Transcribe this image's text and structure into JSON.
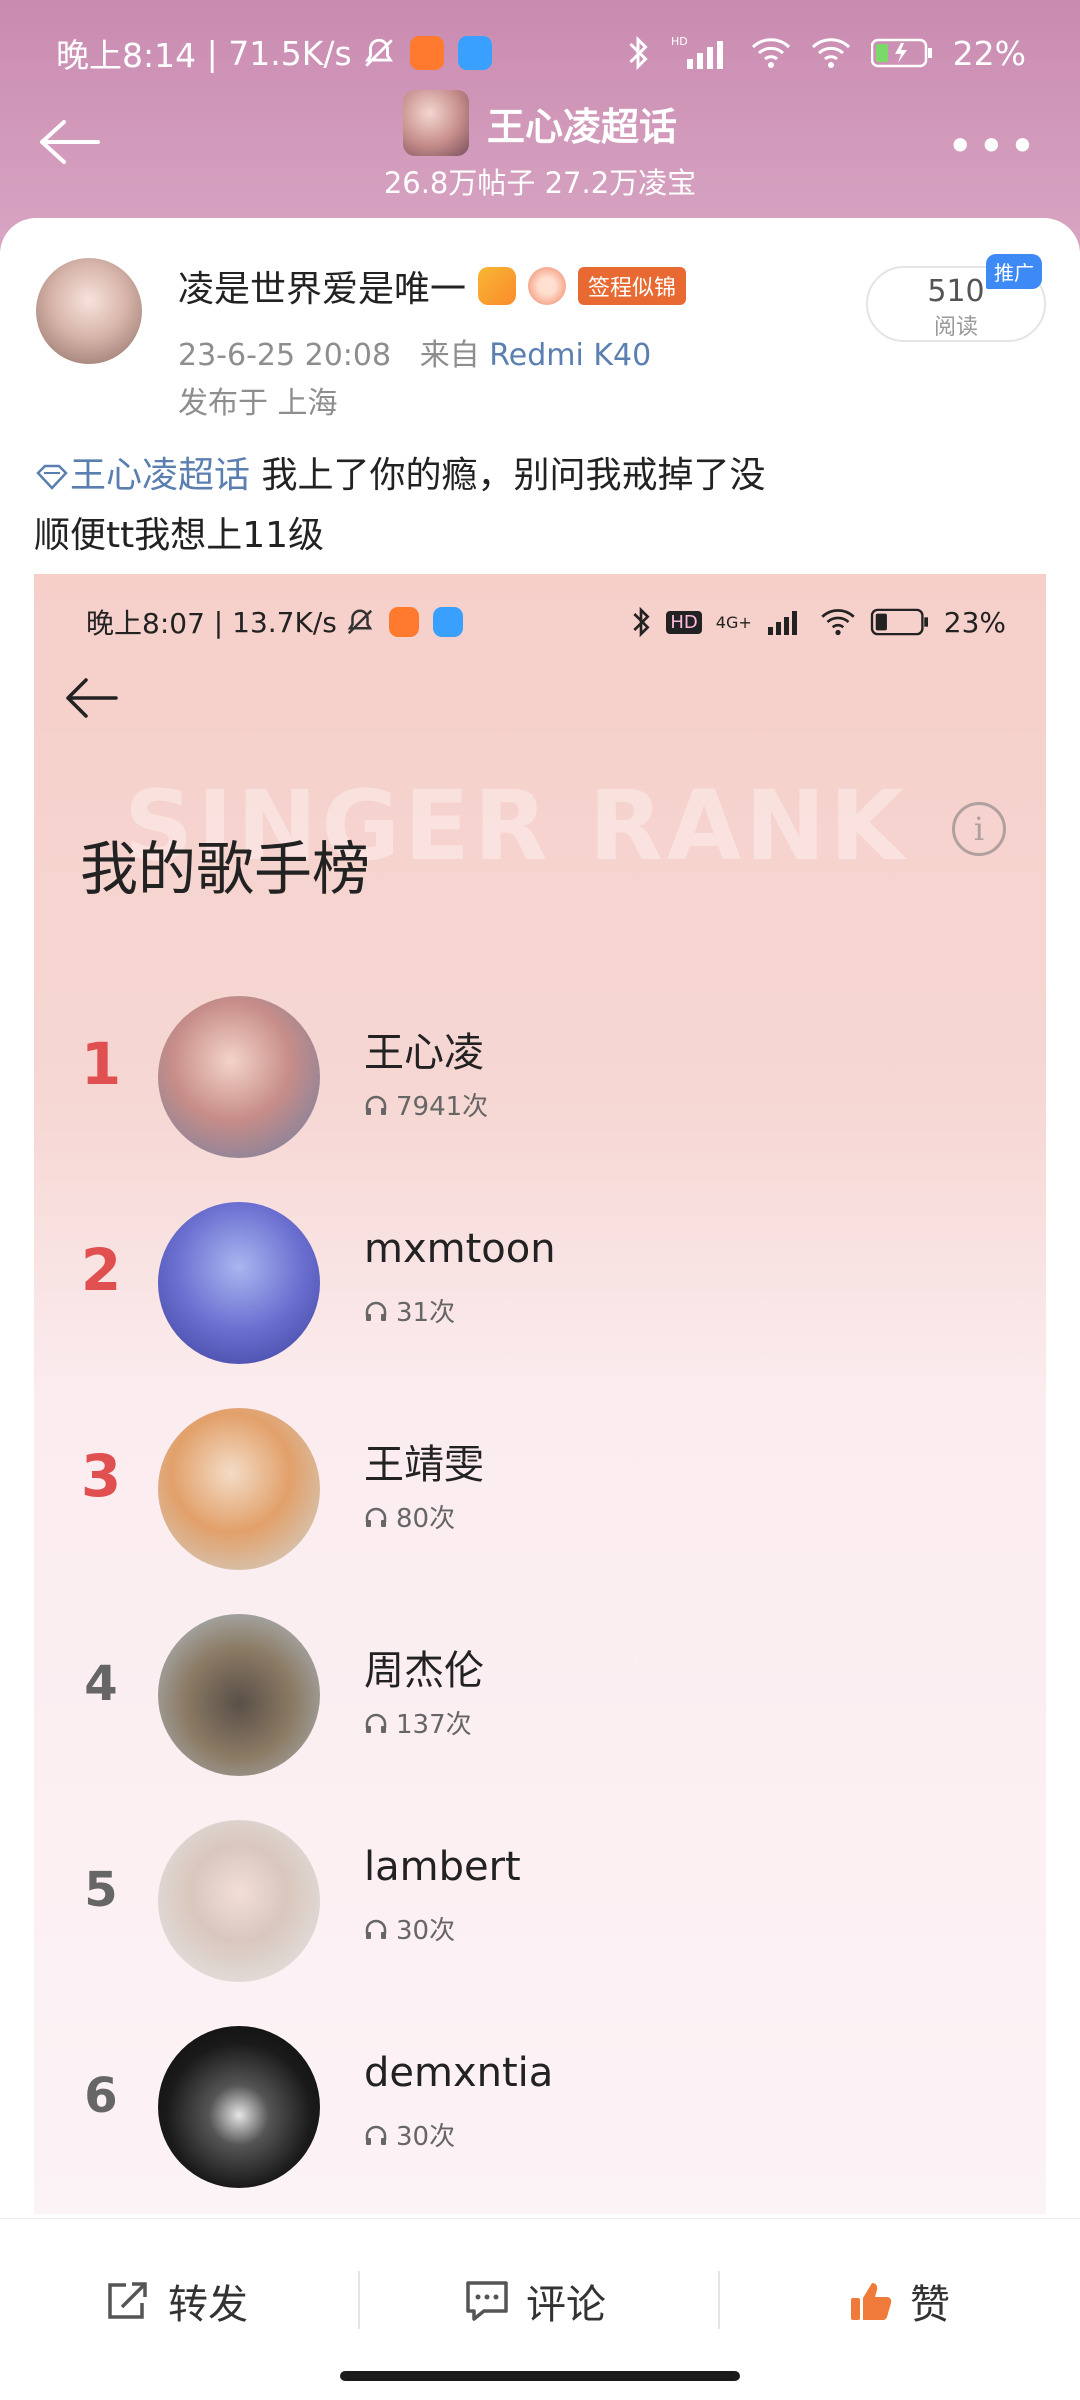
{
  "status_bar": {
    "time": "晚上8:14",
    "speed": "71.5K/s",
    "hd": "HD",
    "battery": "22%"
  },
  "header": {
    "title": "王心凌超话",
    "subtitle": "26.8万帖子 27.2万凌宝"
  },
  "post": {
    "author": "凌是世界爱是唯一",
    "badge": "签程似锦",
    "date": "23-6-25 20:08",
    "from_label": "来自",
    "device": "Redmi K40",
    "location": "发布于 上海",
    "read_count": "510",
    "read_label": "阅读",
    "promo": "推广",
    "topic": "王心凌超话",
    "text_line1": " 我上了你的瘾，别问我戒掉了没",
    "text_line2": "顺便tt我想上11级"
  },
  "inner_screen": {
    "time": "晚上8:07",
    "speed": "13.7K/s",
    "network": "4G+",
    "hd": "HD",
    "battery": "23%",
    "watermark": "SINGER RANK",
    "title": "我的歌手榜",
    "artists": [
      {
        "rank": "1",
        "name": "王心凌",
        "plays": "7941次"
      },
      {
        "rank": "2",
        "name": "mxmtoon",
        "plays": "31次"
      },
      {
        "rank": "3",
        "name": "王靖雯",
        "plays": "80次"
      },
      {
        "rank": "4",
        "name": "周杰伦",
        "plays": "137次"
      },
      {
        "rank": "5",
        "name": "lambert",
        "plays": "30次"
      },
      {
        "rank": "6",
        "name": "demxntia",
        "plays": "30次"
      }
    ]
  },
  "actions": {
    "repost": "转发",
    "comment": "评论",
    "like": "赞"
  },
  "colors": {
    "header_bg": "#c98bb0",
    "rank_red": "#e05050",
    "link_blue": "#5a7fb0",
    "like_orange": "#f07a3a"
  }
}
